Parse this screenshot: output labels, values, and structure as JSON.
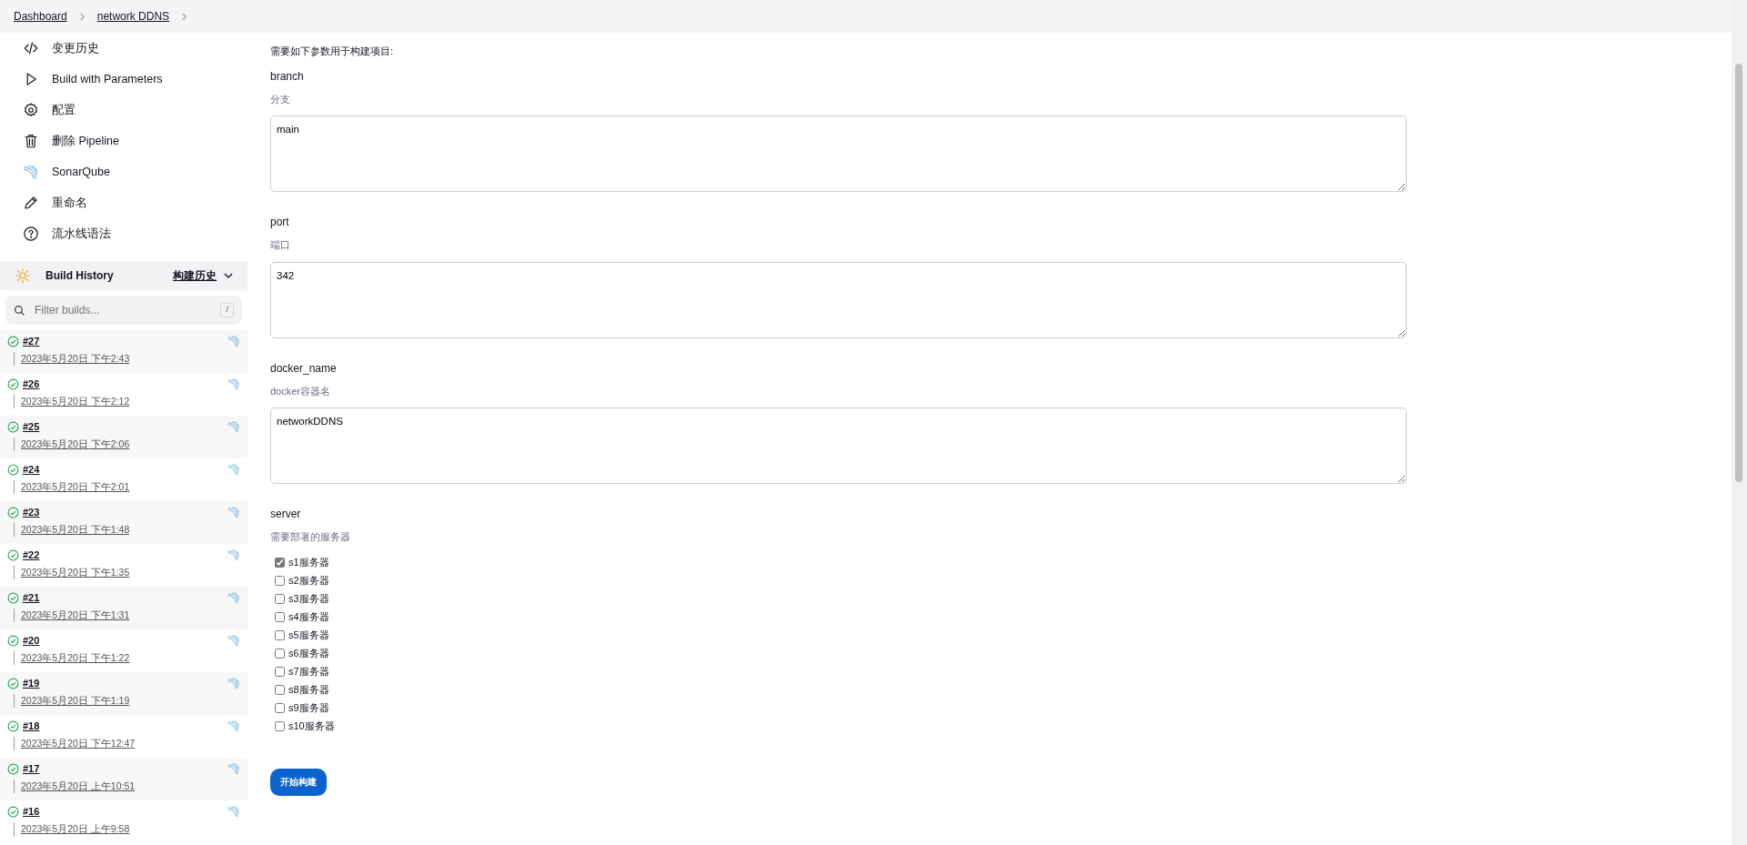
{
  "breadcrumbs": [
    "Dashboard",
    "network DDNS"
  ],
  "sidebar": {
    "items": [
      {
        "kind": "code",
        "label": "变更历史"
      },
      {
        "kind": "play",
        "label": "Build with Parameters"
      },
      {
        "kind": "gear",
        "label": "配置"
      },
      {
        "kind": "trash",
        "label": "删除 Pipeline"
      },
      {
        "kind": "sonar",
        "label": "SonarQube"
      },
      {
        "kind": "pencil",
        "label": "重命名"
      },
      {
        "kind": "help",
        "label": "流水线语法"
      }
    ]
  },
  "build_history": {
    "title": "Build History",
    "link": "构建历史",
    "filter_placeholder": "Filter builds...",
    "shortcut": "/",
    "builds": [
      {
        "number": "#27",
        "time": "2023年5月20日 下午2:43",
        "success": true
      },
      {
        "number": "#26",
        "time": "2023年5月20日 下午2:12",
        "success": true
      },
      {
        "number": "#25",
        "time": "2023年5月20日 下午2:06",
        "success": true
      },
      {
        "number": "#24",
        "time": "2023年5月20日 下午2:01",
        "success": true
      },
      {
        "number": "#23",
        "time": "2023年5月20日 下午1:48",
        "success": true
      },
      {
        "number": "#22",
        "time": "2023年5月20日 下午1:35",
        "success": true
      },
      {
        "number": "#21",
        "time": "2023年5月20日 下午1:31",
        "success": true
      },
      {
        "number": "#20",
        "time": "2023年5月20日 下午1:22",
        "success": true
      },
      {
        "number": "#19",
        "time": "2023年5月20日 下午1:19",
        "success": true
      },
      {
        "number": "#18",
        "time": "2023年5月20日 下午12:47",
        "success": true
      },
      {
        "number": "#17",
        "time": "2023年5月20日 上午10:51",
        "success": true
      },
      {
        "number": "#16",
        "time": "2023年5月20日 上午9:58",
        "success": true
      }
    ]
  },
  "form": {
    "intro": "需要如下参数用于构建项目:",
    "parameters": [
      {
        "kind": "text",
        "name": "branch",
        "description": "分支",
        "value": "main"
      },
      {
        "kind": "text",
        "name": "port",
        "description": "端口",
        "value": "342"
      },
      {
        "kind": "text",
        "name": "docker_name",
        "description": "docker容器名",
        "value": "networkDDNS"
      },
      {
        "kind": "checkboxes",
        "name": "server",
        "description": "需要部署的服务器",
        "options": [
          {
            "label": "s1服务器",
            "checked": true
          },
          {
            "label": "s2服务器",
            "checked": false
          },
          {
            "label": "s3服务器",
            "checked": false
          },
          {
            "label": "s4服务器",
            "checked": false
          },
          {
            "label": "s5服务器",
            "checked": false
          },
          {
            "label": "s6服务器",
            "checked": false
          },
          {
            "label": "s7服务器",
            "checked": false
          },
          {
            "label": "s8服务器",
            "checked": false
          },
          {
            "label": "s9服务器",
            "checked": false
          },
          {
            "label": "s10服务器",
            "checked": false
          }
        ]
      }
    ],
    "submit": "开始构建"
  }
}
